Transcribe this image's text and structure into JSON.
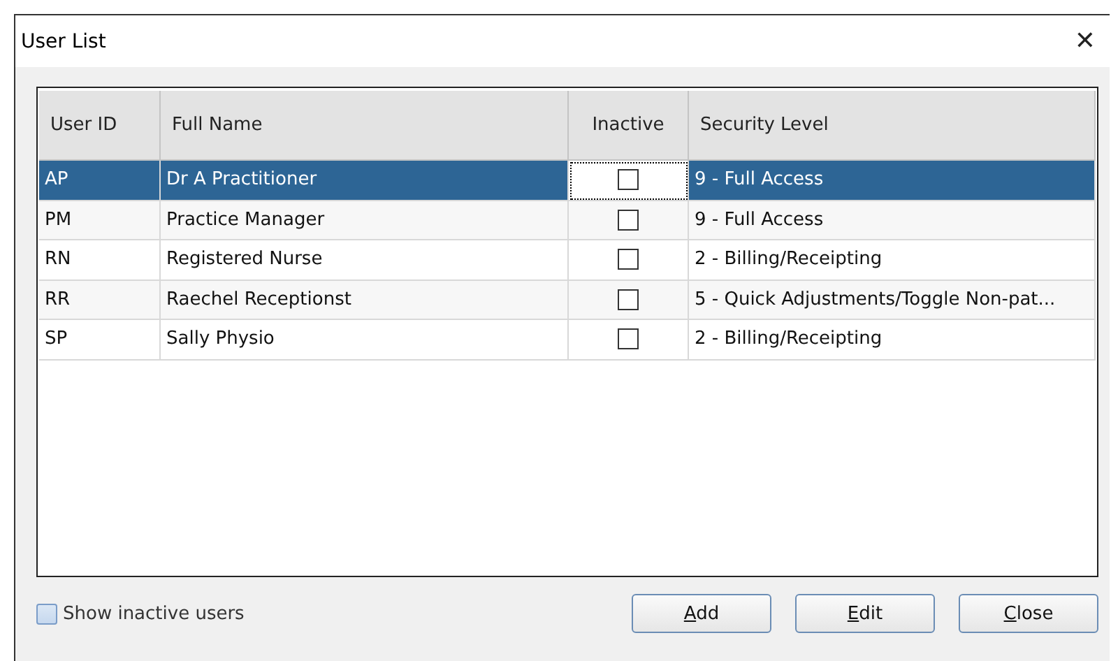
{
  "window": {
    "title": "User List",
    "close": "✕"
  },
  "table": {
    "columns": [
      "User ID",
      "Full Name",
      "Inactive",
      "Security Level"
    ],
    "rows": [
      {
        "user_id": "AP",
        "full_name": "Dr A Practitioner",
        "inactive": false,
        "security_level": "9 - Full Access",
        "selected": true
      },
      {
        "user_id": "PM",
        "full_name": "Practice Manager",
        "inactive": false,
        "security_level": "9 - Full Access",
        "selected": false
      },
      {
        "user_id": "RN",
        "full_name": "Registered Nurse",
        "inactive": false,
        "security_level": "2 - Billing/Receipting",
        "selected": false
      },
      {
        "user_id": "RR",
        "full_name": "Raechel Receptionst",
        "inactive": false,
        "security_level": "5 - Quick Adjustments/Toggle Non-pat...",
        "selected": false
      },
      {
        "user_id": "SP",
        "full_name": "Sally Physio",
        "inactive": false,
        "security_level": "2 - Billing/Receipting",
        "selected": false
      }
    ]
  },
  "show_inactive": {
    "label": "Show inactive users",
    "checked": false
  },
  "buttons": [
    {
      "label": "Add",
      "mnemonic_underlined": true
    },
    {
      "label": "Edit",
      "mnemonic_underlined": true
    },
    {
      "label": "Close",
      "mnemonic_underlined": true
    }
  ]
}
